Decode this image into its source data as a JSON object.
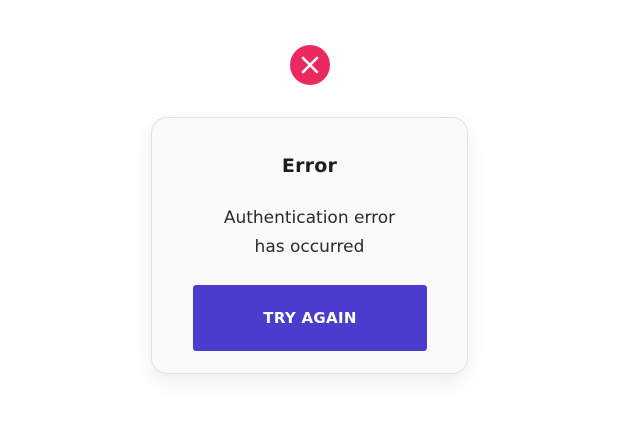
{
  "icon": {
    "name": "close-icon",
    "color": "#ea2a5e"
  },
  "dialog": {
    "title": "Error",
    "message_line1": "Authentication error",
    "message_line2": "has occurred",
    "button_label": "TRY AGAIN",
    "button_color": "#4a3ccc"
  }
}
